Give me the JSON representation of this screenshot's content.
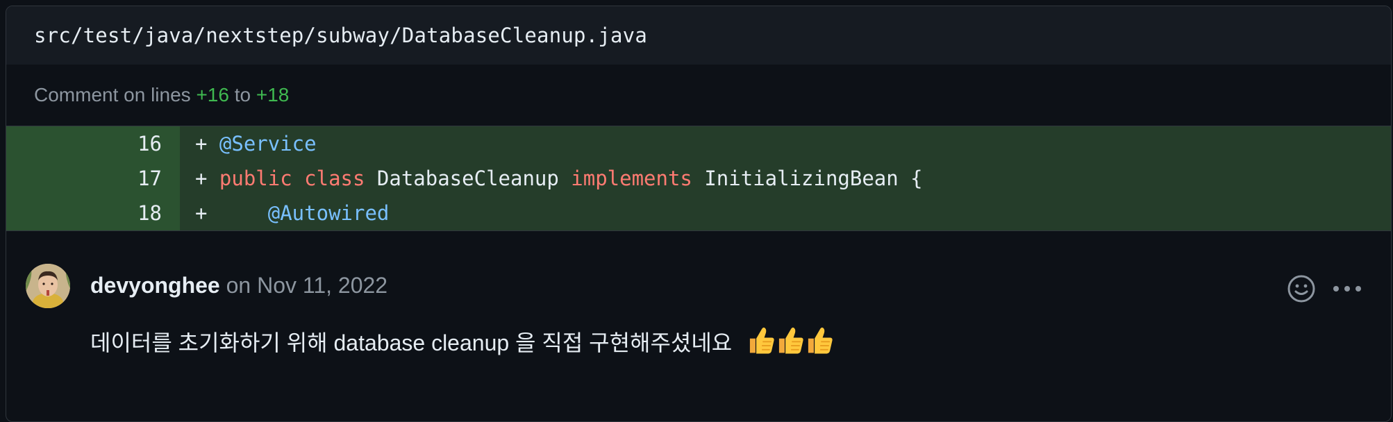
{
  "file": {
    "path": "src/test/java/nextstep/subway/DatabaseCleanup.java"
  },
  "comment_range": {
    "prefix": "Comment on lines",
    "from": "+16",
    "to_word": "to",
    "to": "+18"
  },
  "diff": {
    "lines": [
      {
        "number": "16",
        "tokens": [
          {
            "type": "plus",
            "text": "+ "
          },
          {
            "type": "ann",
            "text": "@Service"
          }
        ]
      },
      {
        "number": "17",
        "tokens": [
          {
            "type": "plus",
            "text": "+ "
          },
          {
            "type": "kw",
            "text": "public"
          },
          {
            "type": "plain",
            "text": " "
          },
          {
            "type": "kw",
            "text": "class"
          },
          {
            "type": "plain",
            "text": " DatabaseCleanup "
          },
          {
            "type": "kw",
            "text": "implements"
          },
          {
            "type": "plain",
            "text": " InitializingBean {"
          }
        ]
      },
      {
        "number": "18",
        "tokens": [
          {
            "type": "plus",
            "text": "+     "
          },
          {
            "type": "ann",
            "text": "@Autowired"
          }
        ]
      }
    ]
  },
  "comment": {
    "author": "devyonghee",
    "date": "on Nov 11, 2022",
    "body": "데이터를 초기화하기 위해 database cleanup 을 직접 구현해주셨네요",
    "reaction_icons": [
      "thumbs-up-icon",
      "thumbs-up-icon",
      "thumbs-up-icon"
    ],
    "actions": [
      "smiley-icon",
      "kebab-menu-icon"
    ]
  },
  "colors": {
    "background": "#0d1117",
    "header": "#161b22",
    "diff_line_number_bg": "#2b5230",
    "diff_code_bg": "#253d2a",
    "addition_green": "#3fb950",
    "annotation_blue": "#79c0ff",
    "keyword_red": "#ff7b72",
    "muted_text": "#8d96a0"
  }
}
